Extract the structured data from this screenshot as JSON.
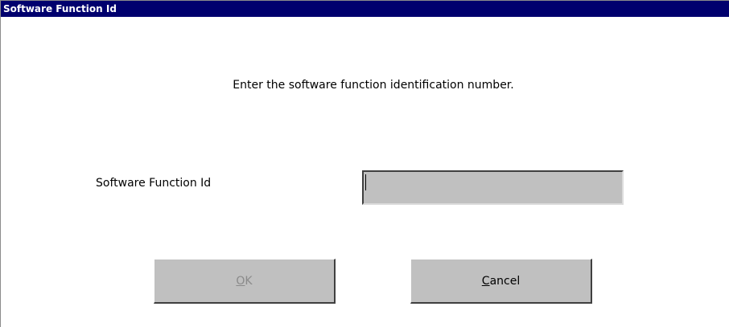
{
  "window": {
    "title": "Software Function Id"
  },
  "dialog": {
    "prompt": "Enter the software function identification number.",
    "field_label": "Software Function Id",
    "field_value": ""
  },
  "buttons": {
    "ok": {
      "mnemonic": "O",
      "rest": "K",
      "enabled": false
    },
    "cancel": {
      "mnemonic": "C",
      "rest": "ancel",
      "enabled": true
    }
  },
  "colors": {
    "titlebar": "#00006e",
    "face": "#c0c0c0",
    "disabled_text": "#8a8a8a"
  }
}
